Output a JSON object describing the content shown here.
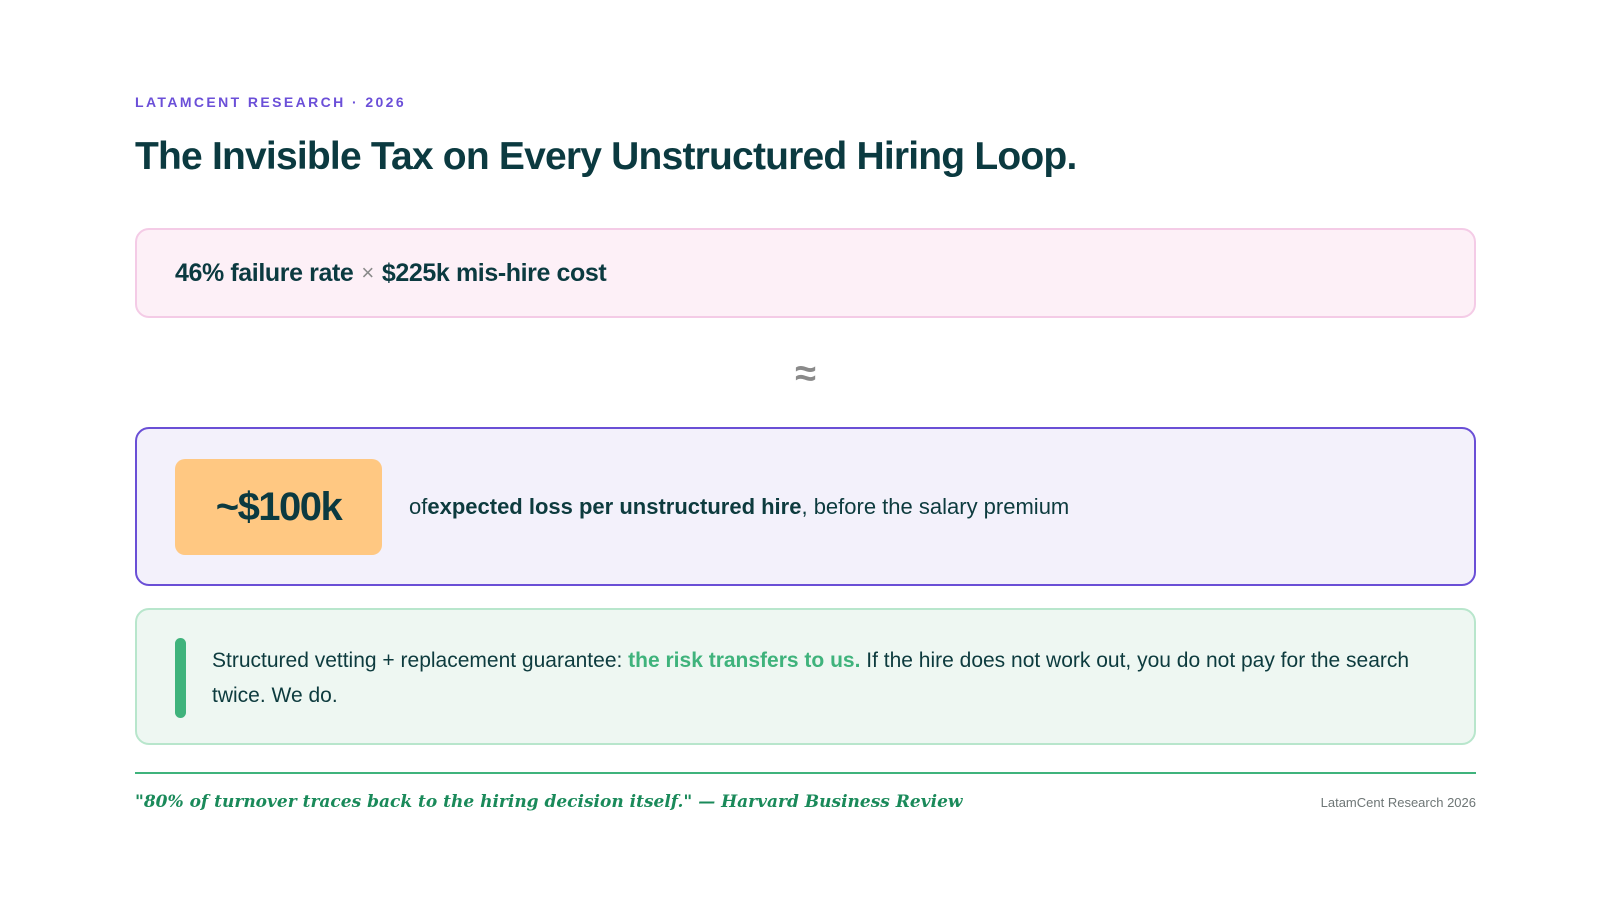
{
  "eyebrow": "LATAMCENT RESEARCH · 2026",
  "headline": "The Invisible Tax on Every Unstructured Hiring Loop.",
  "formula": {
    "left": "46% failure rate",
    "operator": "×",
    "right": "$225k mis-hire cost"
  },
  "approx_symbol": "≈",
  "result": {
    "value": "~$100k",
    "prefix": "of ",
    "bold": "expected loss per unstructured hire",
    "suffix": ", before the salary premium"
  },
  "guarantee": {
    "lead": "Structured vetting + replacement guarantee: ",
    "highlight": "the risk transfers to us.",
    "tail": " If the hire does not work out, you do not pay for the search twice. We do."
  },
  "footer": {
    "quote": "\"80% of turnover traces back to the hiring decision itself.\" — Harvard Business Review",
    "note": "LatamCent Research 2026"
  },
  "colors": {
    "accent_purple": "#6b4fd8",
    "accent_green": "#3fb37c",
    "navy_text": "#0b3a40",
    "pill_orange": "#ffc882",
    "pink_panel": "#fdf0f7",
    "lavender_panel": "#f3f1fb",
    "mint_panel": "#eef7f2"
  }
}
